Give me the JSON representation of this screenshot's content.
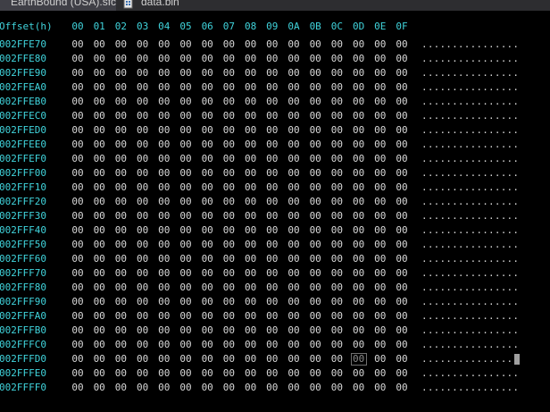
{
  "tabs": [
    {
      "label": "EarthBound (USA).sfc",
      "active": false,
      "icon": "file-icon"
    },
    {
      "label": "data.bin",
      "active": true,
      "icon": "binary-file-icon"
    }
  ],
  "hex_view": {
    "offset_header": "Offset(h)",
    "column_headers": [
      "00",
      "01",
      "02",
      "03",
      "04",
      "05",
      "06",
      "07",
      "08",
      "09",
      "0A",
      "0B",
      "0C",
      "0D",
      "0E",
      "0F"
    ],
    "rows": [
      {
        "offset": "002FFE70",
        "ascii": "................"
      },
      {
        "offset": "002FFE80",
        "ascii": "................"
      },
      {
        "offset": "002FFE90",
        "ascii": "................"
      },
      {
        "offset": "002FFEA0",
        "ascii": "................"
      },
      {
        "offset": "002FFEB0",
        "ascii": "................"
      },
      {
        "offset": "002FFEC0",
        "ascii": "................"
      },
      {
        "offset": "002FFED0",
        "ascii": "................"
      },
      {
        "offset": "002FFEE0",
        "ascii": "................"
      },
      {
        "offset": "002FFEF0",
        "ascii": "................"
      },
      {
        "offset": "002FFF00",
        "ascii": "................"
      },
      {
        "offset": "002FFF10",
        "ascii": "................"
      },
      {
        "offset": "002FFF20",
        "ascii": "................"
      },
      {
        "offset": "002FFF30",
        "ascii": "................"
      },
      {
        "offset": "002FFF40",
        "ascii": "................"
      },
      {
        "offset": "002FFF50",
        "ascii": "................"
      },
      {
        "offset": "002FFF60",
        "ascii": "................"
      },
      {
        "offset": "002FFF70",
        "ascii": "................"
      },
      {
        "offset": "002FFF80",
        "ascii": "................"
      },
      {
        "offset": "002FFF90",
        "ascii": "................"
      },
      {
        "offset": "002FFFA0",
        "ascii": "................"
      },
      {
        "offset": "002FFFB0",
        "ascii": "................"
      },
      {
        "offset": "002FFFC0",
        "ascii": "................"
      },
      {
        "offset": "002FFFD0",
        "ascii": "................"
      },
      {
        "offset": "002FFFE0",
        "ascii": "................"
      },
      {
        "offset": "002FFFF0",
        "ascii": "................"
      }
    ],
    "byte_value": "00",
    "selected_row_offset": "002FFFD0",
    "selected_column": "0D",
    "colors": {
      "background": "#000000",
      "offset_text": "#40d4dc",
      "byte_text": "#d8d8d8",
      "tab_bar": "#2d2d30"
    }
  }
}
